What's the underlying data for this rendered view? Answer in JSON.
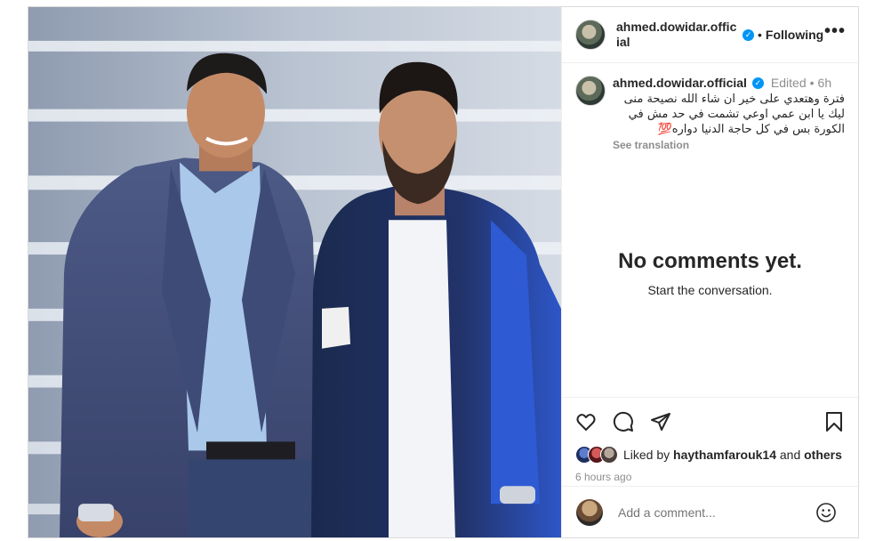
{
  "header": {
    "username": "ahmed.dowidar.official",
    "verified": true,
    "follow_status": "Following",
    "more_icon": "more-horizontal-icon"
  },
  "caption": {
    "username": "ahmed.dowidar.official",
    "edited": "Edited",
    "time": "6h",
    "text": "فترة وهتعدي على خير ان شاء الله نصيحة منى ليك يا ابن عمي اوعي تشمت في حد مش في الكورة بس في كل حاجة الدنيا دواره💯",
    "see_translation": "See translation"
  },
  "comments": {
    "empty_title": "No comments yet.",
    "empty_subtitle": "Start the conversation."
  },
  "actions": {
    "icons": [
      "heart-icon",
      "comment-icon",
      "share-icon",
      "bookmark-icon"
    ]
  },
  "likes": {
    "prefix": "Liked by",
    "user": "haythamfarouk14",
    "and": "and",
    "others": "others"
  },
  "timestamp": "6 hours ago",
  "comment_box": {
    "placeholder": "Add a comment...",
    "emoji_icon": "emoji-icon"
  },
  "colors": {
    "verified": "#0095f6",
    "muted": "#8e8e8e",
    "border": "#dbdbdb"
  }
}
